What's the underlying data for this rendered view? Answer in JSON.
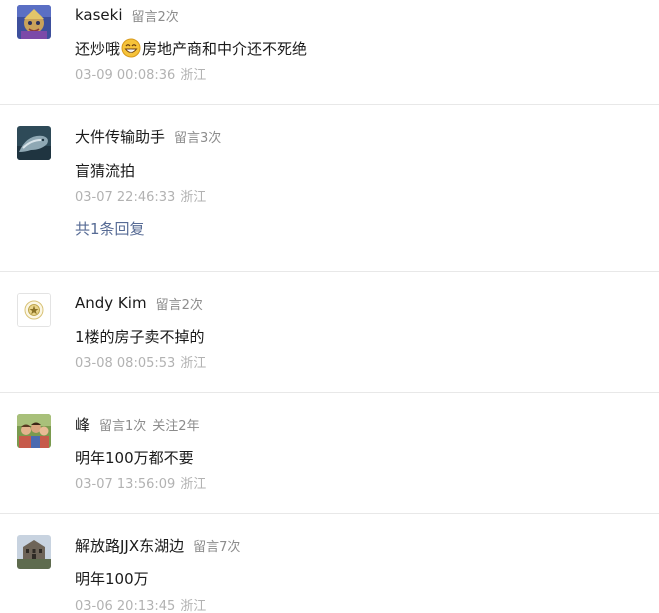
{
  "comments": [
    {
      "name": "kaseki",
      "meta": "留言2次",
      "content_before": "还炒哦",
      "content_emoji": "grin-emoji",
      "content_after": "房地产商和中介还不死绝",
      "time": "03-09 00:08:36",
      "location": "浙江"
    },
    {
      "name": "大件传输助手",
      "meta": "留言3次",
      "content": "盲猜流拍",
      "time": "03-07 22:46:33",
      "location": "浙江",
      "replies": "共1条回复"
    },
    {
      "name": "Andy Kim",
      "meta": "留言2次",
      "content": "1楼的房子卖不掉的",
      "time": "03-08 08:05:53",
      "location": "浙江"
    },
    {
      "name": "峰",
      "meta": "留言1次",
      "meta2": "关注2年",
      "content": "明年100万都不要",
      "time": "03-07 13:56:09",
      "location": "浙江"
    },
    {
      "name": "解放路JJX东湖边",
      "meta": "留言7次",
      "content": "明年100万",
      "time": "03-06 20:13:45",
      "location": "浙江"
    }
  ]
}
